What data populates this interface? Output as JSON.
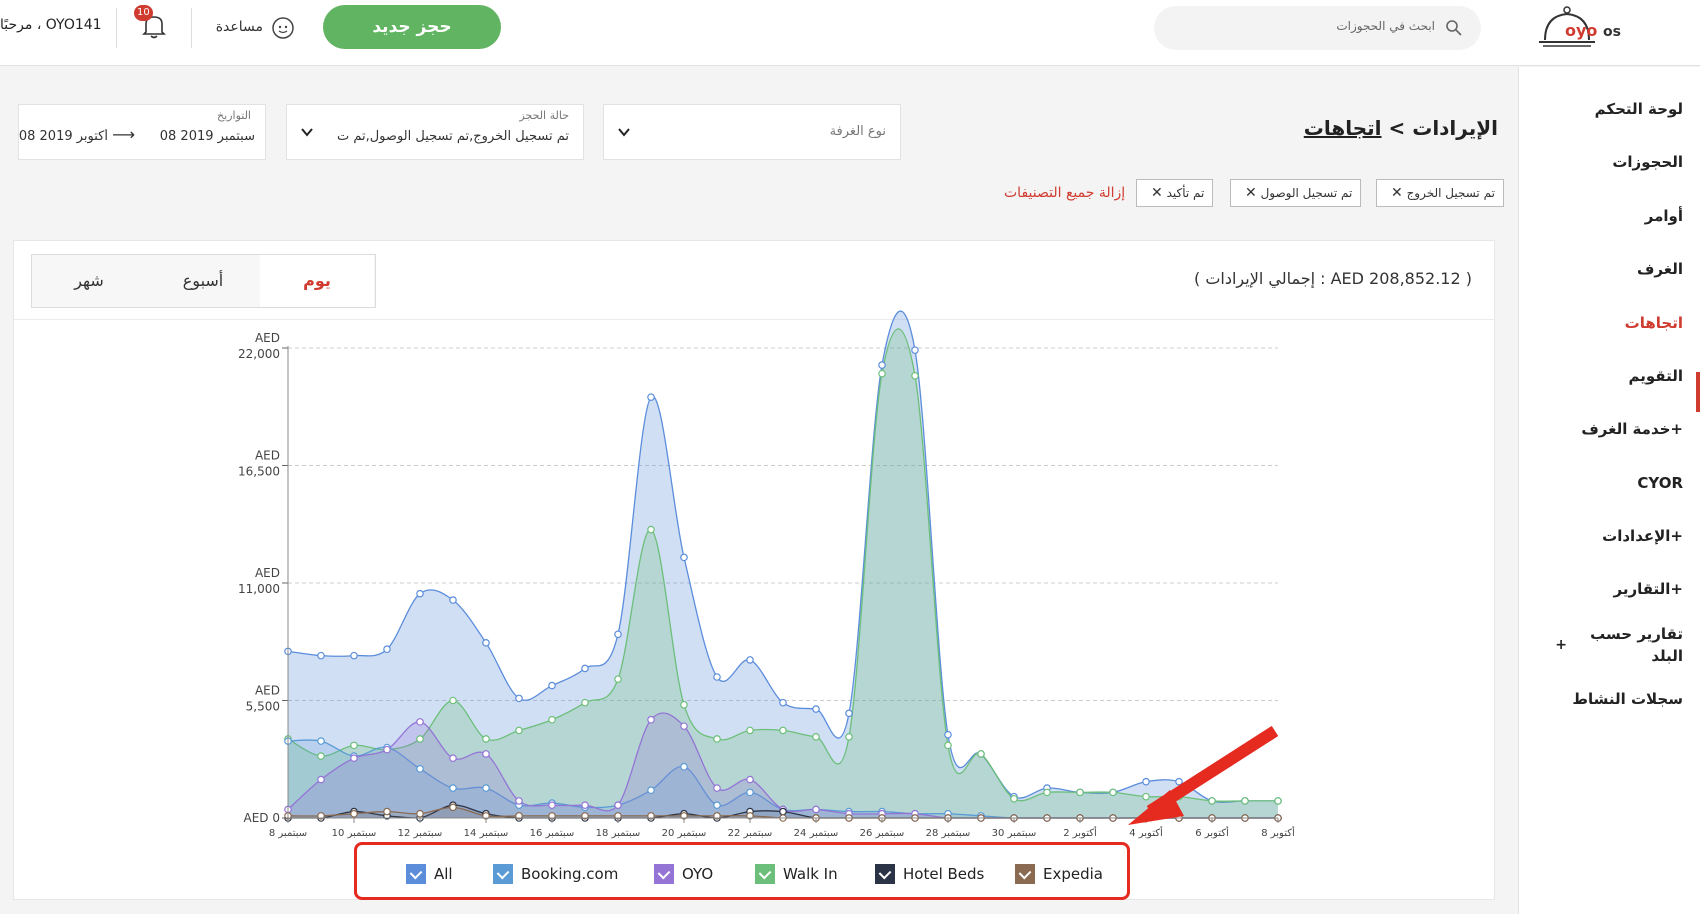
{
  "topbar": {
    "logo_text": "oyo",
    "logo_suffix": "os",
    "search_placeholder": "ابحث في الحجوزات",
    "new_booking_label": "حجز جديد",
    "help_label": "مساعدة",
    "notification_count": "10",
    "greeting": "مرحبًا ، OYO141"
  },
  "sidebar": {
    "items": [
      {
        "label": "لوحة التحكم"
      },
      {
        "label": "الحجوزات"
      },
      {
        "label": "أوامر"
      },
      {
        "label": "الغرف"
      },
      {
        "label": "اتجاهات"
      },
      {
        "label": "التقويم"
      },
      {
        "label": "خدمة الغرف+"
      },
      {
        "label": "CYOR"
      },
      {
        "label": "الإعدادات+"
      },
      {
        "label": "التقارير+"
      },
      {
        "label": "تقارير حسب"
      },
      {
        "label": "البلد"
      },
      {
        "label": "سجلات النشاط"
      }
    ],
    "active": "اتجاهات",
    "plus": "+"
  },
  "breadcrumb": {
    "link": "اتجاهات",
    "separator": ">",
    "current": "الإيرادات"
  },
  "filters": {
    "room_type": {
      "placeholder": "نوع الغرفة"
    },
    "booking_status": {
      "label": "حالة الحجز",
      "value": "تم تسجيل الخروج,تم تسجيل الوصول,تم ت"
    },
    "dates": {
      "label": "التواريخ",
      "from": "08 سبتمبر 2019",
      "to": "08 أكتوبر 2019",
      "arrow": "⟶"
    }
  },
  "chips": [
    "تم تسجيل الخروج",
    "تم تسجيل الوصول",
    "تم تأكيد"
  ],
  "chip_close": "✕",
  "clear_all": "إزالة جميع التصنيفات",
  "card": {
    "total_label": "( إجمالي الإيرادات : AED 208,852.12 )",
    "segments": [
      {
        "label": "يوم",
        "active": true
      },
      {
        "label": "أسبوع",
        "active": false
      },
      {
        "label": "شهر",
        "active": false
      }
    ]
  },
  "legend": [
    {
      "name": "All",
      "color": "#5b8ddb"
    },
    {
      "name": "Booking.com",
      "color": "#5a9bd5"
    },
    {
      "name": "OYO",
      "color": "#9475d6"
    },
    {
      "name": "Walk In",
      "color": "#6cbf7a"
    },
    {
      "name": "Hotel Beds",
      "color": "#2b3446"
    },
    {
      "name": "Expedia",
      "color": "#8a6a50"
    }
  ],
  "chart_data": {
    "type": "area",
    "y_ticks": [
      {
        "line1": "AED",
        "line2": "22,000",
        "value": 22000
      },
      {
        "line1": "AED",
        "line2": "16,500",
        "value": 16500
      },
      {
        "line1": "AED",
        "line2": "11,000",
        "value": 11000
      },
      {
        "line1": "AED",
        "line2": "5,500",
        "value": 5500
      },
      {
        "line1": "",
        "line2": "AED 0",
        "value": 0
      }
    ],
    "ylim": [
      0,
      22000
    ],
    "x_tick_labels": [
      "8 سبتمبر",
      "10 سبتمبر",
      "12 سبتمبر",
      "14 سبتمبر",
      "16 سبتمبر",
      "18 سبتمبر",
      "20 سبتمبر",
      "22 سبتمبر",
      "24 سبتمبر",
      "26 سبتمبر",
      "28 سبتمبر",
      "30 سبتمبر",
      "2 أكتوبر",
      "4 أكتوبر",
      "6 أكتوبر",
      "8 أكتوبر"
    ],
    "series": [
      {
        "name": "All",
        "color": "#5b8ddb",
        "fill": "rgba(91,141,219,0.28)",
        "values": [
          7800,
          7600,
          7600,
          7900,
          10500,
          10200,
          8200,
          5600,
          6200,
          7000,
          8600,
          19700,
          12200,
          6600,
          7400,
          5400,
          5100,
          4900,
          21200,
          21900,
          3900,
          3000,
          1000,
          1400,
          1200,
          1200,
          1700,
          1700,
          800,
          800,
          800
        ]
      },
      {
        "name": "Walk In",
        "color": "#6cbf7a",
        "fill": "rgba(108,191,122,0.28)",
        "values": [
          3700,
          2900,
          3400,
          3200,
          3700,
          5500,
          3700,
          4100,
          4600,
          5400,
          6500,
          13500,
          5300,
          3700,
          4100,
          4100,
          3800,
          3800,
          20800,
          20700,
          3400,
          3000,
          900,
          1200,
          1200,
          1200,
          1000,
          1000,
          800,
          800,
          800
        ]
      },
      {
        "name": "Booking.com",
        "color": "#5a9bd5",
        "fill": "rgba(90,155,213,0.20)",
        "values": [
          3600,
          3600,
          2900,
          3300,
          2300,
          1400,
          1400,
          600,
          700,
          500,
          600,
          1300,
          2400,
          600,
          1200,
          400,
          400,
          300,
          300,
          200,
          200,
          100,
          0,
          0,
          0,
          0,
          0,
          0,
          0,
          0,
          0
        ]
      },
      {
        "name": "OYO",
        "color": "#9475d6",
        "fill": "rgba(148,117,214,0.25)",
        "values": [
          400,
          1800,
          2800,
          3200,
          4500,
          2800,
          3000,
          800,
          600,
          600,
          600,
          4600,
          4300,
          1400,
          1800,
          400,
          400,
          200,
          200,
          200,
          0,
          0,
          0,
          0,
          0,
          0,
          0,
          0,
          0,
          0,
          0
        ]
      },
      {
        "name": "Hotel Beds",
        "color": "#2b3446",
        "fill": "rgba(43,52,70,0.10)",
        "values": [
          0,
          0,
          300,
          100,
          0,
          600,
          200,
          0,
          0,
          0,
          0,
          0,
          200,
          0,
          300,
          300,
          0,
          0,
          0,
          0,
          0,
          0,
          0,
          0,
          0,
          0,
          0,
          0,
          0,
          0,
          0
        ]
      },
      {
        "name": "Expedia",
        "color": "#8a6a50",
        "fill": "rgba(138,106,80,0.12)",
        "values": [
          100,
          100,
          200,
          300,
          200,
          500,
          100,
          100,
          100,
          100,
          100,
          100,
          100,
          100,
          100,
          0,
          0,
          0,
          0,
          0,
          0,
          0,
          0,
          0,
          0,
          0,
          0,
          0,
          0,
          0,
          0
        ]
      }
    ]
  }
}
